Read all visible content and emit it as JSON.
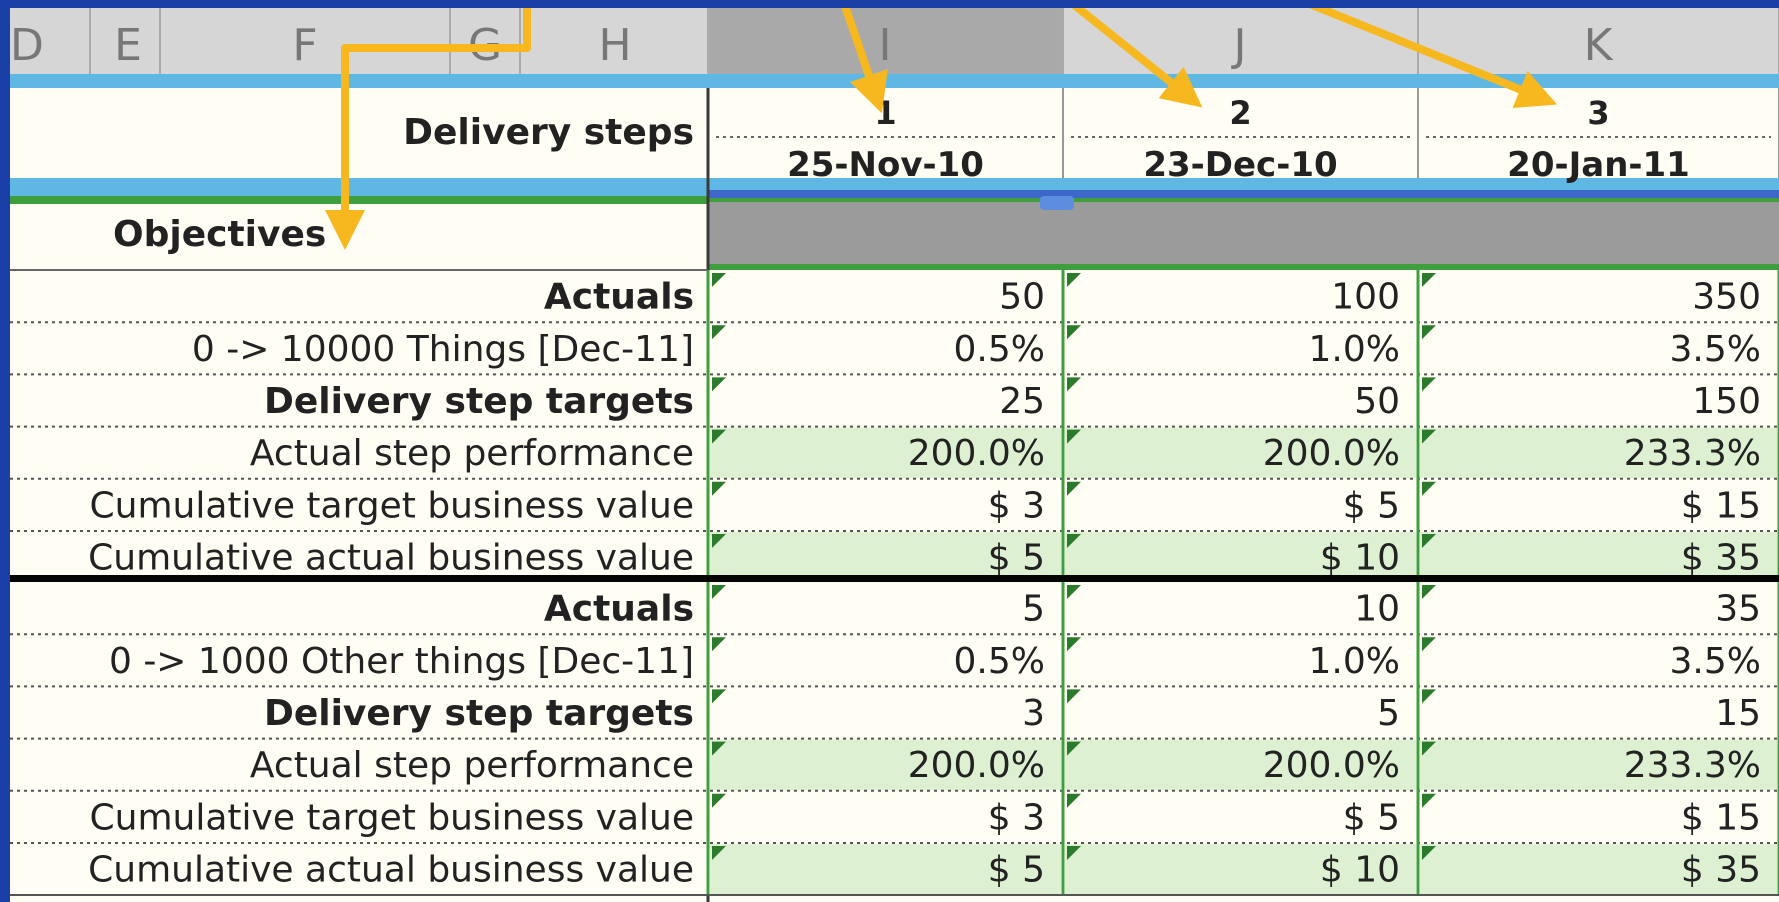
{
  "column_headers": [
    "D",
    "E",
    "F",
    "G",
    "H",
    "I",
    "J",
    "K"
  ],
  "steps_header": {
    "label": "Delivery steps",
    "step_numbers": [
      "1",
      "2",
      "3"
    ],
    "dates": [
      "25-Nov-10",
      "23-Dec-10",
      "20-Jan-11"
    ]
  },
  "objectives_label": "Objectives",
  "groups": [
    {
      "rows": [
        {
          "label": "Actuals",
          "bold": true,
          "green": false,
          "values": [
            "50",
            "100",
            "350"
          ]
        },
        {
          "label": "0 -> 10000 Things [Dec-11]",
          "bold": false,
          "green": false,
          "values": [
            "0.5%",
            "1.0%",
            "3.5%"
          ]
        },
        {
          "label": "Delivery step targets",
          "bold": true,
          "green": false,
          "values": [
            "25",
            "50",
            "150"
          ]
        },
        {
          "label": "Actual step performance",
          "bold": false,
          "green": true,
          "values": [
            "200.0%",
            "200.0%",
            "233.3%"
          ]
        },
        {
          "label": "Cumulative target business value",
          "bold": false,
          "green": false,
          "values": [
            "$ 3",
            "$ 5",
            "$ 15"
          ]
        },
        {
          "label": "Cumulative actual business value",
          "bold": false,
          "green": true,
          "values": [
            "$ 5",
            "$ 10",
            "$ 35"
          ]
        }
      ]
    },
    {
      "rows": [
        {
          "label": "Actuals",
          "bold": true,
          "green": false,
          "values": [
            "5",
            "10",
            "35"
          ]
        },
        {
          "label": "0 -> 1000 Other things [Dec-11]",
          "bold": false,
          "green": false,
          "values": [
            "0.5%",
            "1.0%",
            "3.5%"
          ]
        },
        {
          "label": "Delivery step targets",
          "bold": true,
          "green": false,
          "values": [
            "3",
            "5",
            "15"
          ]
        },
        {
          "label": "Actual step performance",
          "bold": false,
          "green": true,
          "values": [
            "200.0%",
            "200.0%",
            "233.3%"
          ]
        },
        {
          "label": "Cumulative target business value",
          "bold": false,
          "green": false,
          "values": [
            "$ 3",
            "$ 5",
            "$ 15"
          ]
        },
        {
          "label": "Cumulative actual business value",
          "bold": false,
          "green": true,
          "values": [
            "$ 5",
            "$ 10",
            "$ 35"
          ]
        }
      ]
    }
  ],
  "colors": {
    "frame": "#1a3fa6",
    "header_bg": "#d6d6d6",
    "selected_header_bg": "#a9a9a9",
    "blue_band": "#5fb8e4",
    "green_border": "#3f9f3f",
    "green_fill": "#ddf0d2",
    "cell_bg": "#fffdf4",
    "annotation": "#f6b81e"
  }
}
